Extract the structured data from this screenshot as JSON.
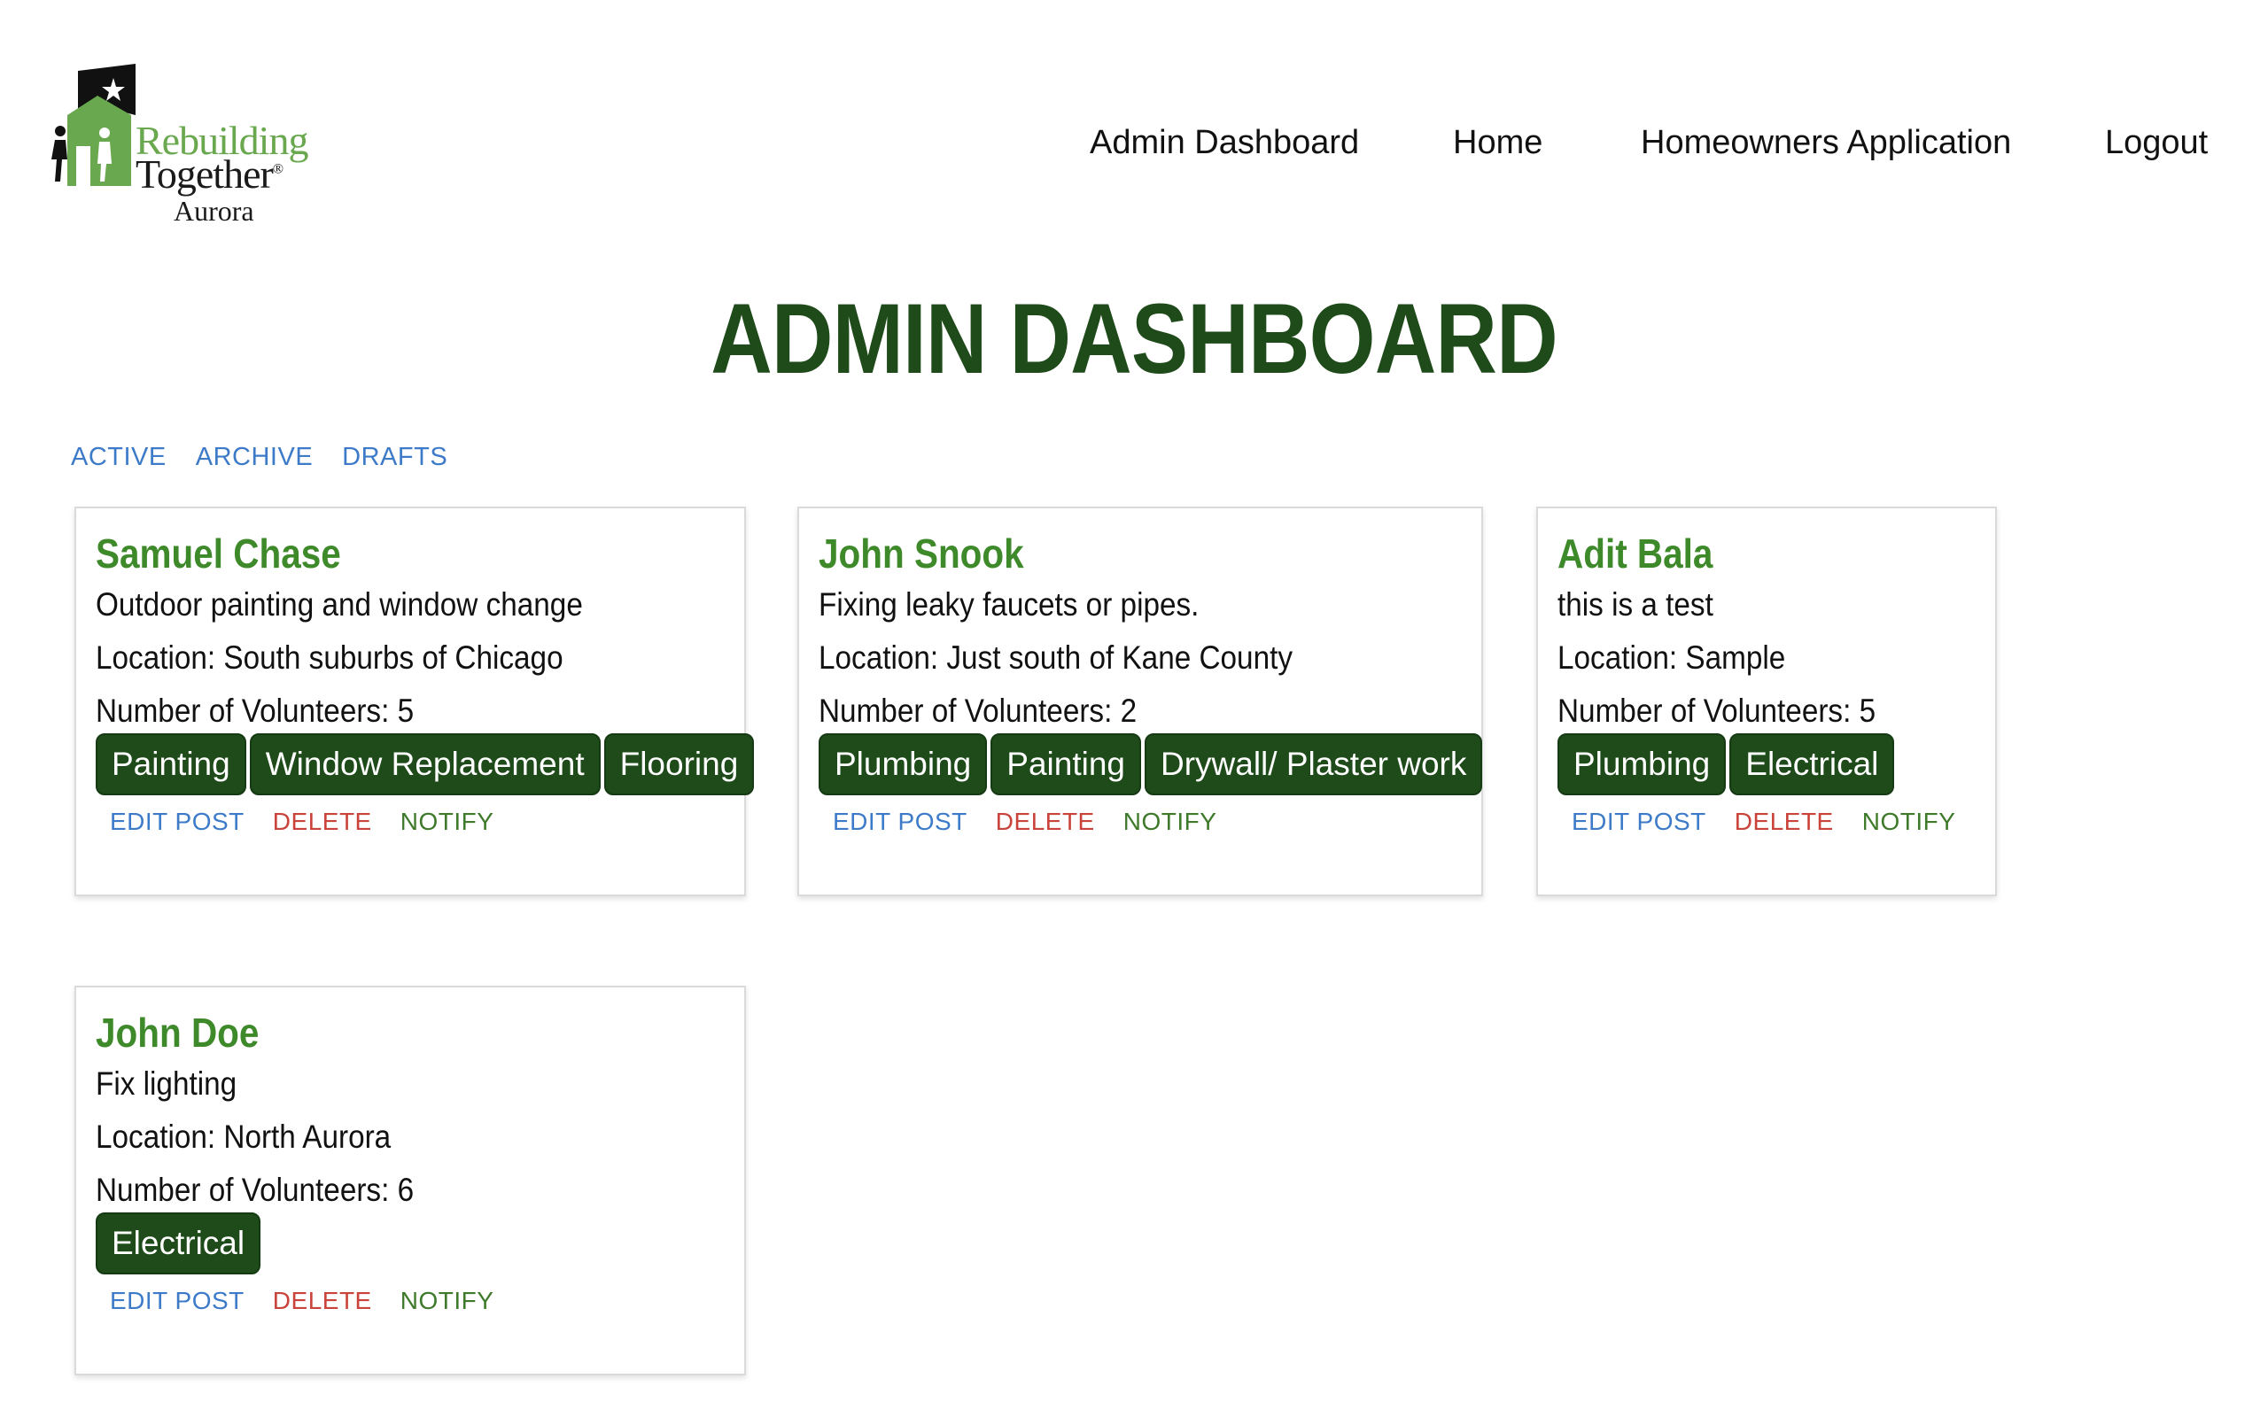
{
  "logo": {
    "line1": "Rebuilding",
    "line2": "Together",
    "line3": "Aurora"
  },
  "nav": {
    "items": [
      "Admin Dashboard",
      "Home",
      "Homeowners Application",
      "Logout"
    ]
  },
  "page": {
    "title": "ADMIN DASHBOARD"
  },
  "tabs": [
    "ACTIVE",
    "ARCHIVE",
    "DRAFTS"
  ],
  "actions": {
    "edit": "EDIT POST",
    "delete": "DELETE",
    "notify": "NOTIFY"
  },
  "cards": [
    {
      "name": "Samuel Chase",
      "description": "Outdoor painting and window change",
      "location": "Location: South suburbs of Chicago",
      "volunteers": "Number of Volunteers: 5",
      "tags": [
        "Painting",
        "Window Replacement",
        "Flooring"
      ]
    },
    {
      "name": "John Snook",
      "description": "Fixing leaky faucets or pipes.",
      "location": "Location: Just south of Kane County",
      "volunteers": "Number of Volunteers: 2",
      "tags": [
        "Plumbing",
        "Painting",
        "Drywall/ Plaster work"
      ]
    },
    {
      "name": "Adit Bala",
      "description": "this is a test",
      "location": "Location: Sample",
      "volunteers": "Number of Volunteers: 5",
      "tags": [
        "Plumbing",
        "Electrical"
      ]
    },
    {
      "name": "John Doe",
      "description": "Fix lighting",
      "location": "Location: North Aurora",
      "volunteers": "Number of Volunteers: 6",
      "tags": [
        "Electrical"
      ]
    }
  ],
  "colors": {
    "brand_green": "#1f4a1a",
    "name_green": "#3e8a2a",
    "link_blue": "#3d7bc9",
    "delete_red": "#c9433a"
  }
}
